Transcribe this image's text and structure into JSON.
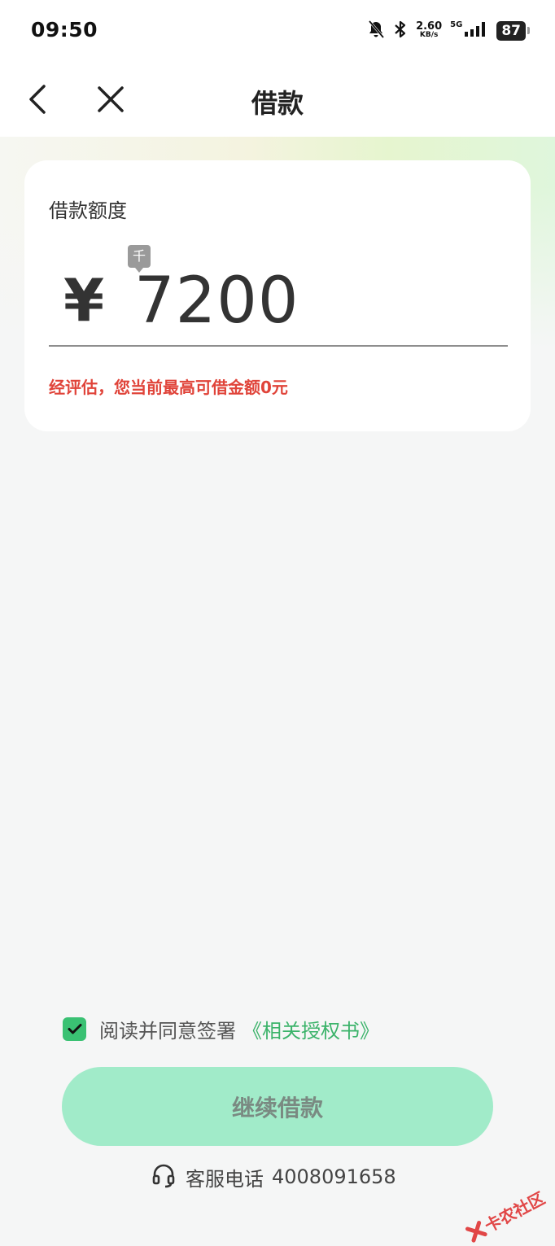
{
  "status_bar": {
    "time": "09:50",
    "net_speed_value": "2.60",
    "net_speed_unit": "KB/s",
    "network_type": "5G",
    "battery": "87"
  },
  "nav": {
    "title": "借款"
  },
  "card": {
    "title": "借款额度",
    "unit_tag": "千",
    "currency": "¥",
    "amount": "7200",
    "note": "经评估，您当前最高可借金额0元"
  },
  "agreement": {
    "checked": true,
    "text": "阅读并同意签署",
    "link": "《相关授权书》"
  },
  "continue_button": {
    "label": "继续借款"
  },
  "service": {
    "label": "客服电话",
    "phone": "4008091658"
  },
  "watermark": {
    "text": "卡农社区"
  },
  "colors": {
    "accent_green": "#3ac173",
    "link_green": "#3bb36a",
    "button_bg": "#a1ebc9",
    "warning_red": "#e0443a"
  }
}
